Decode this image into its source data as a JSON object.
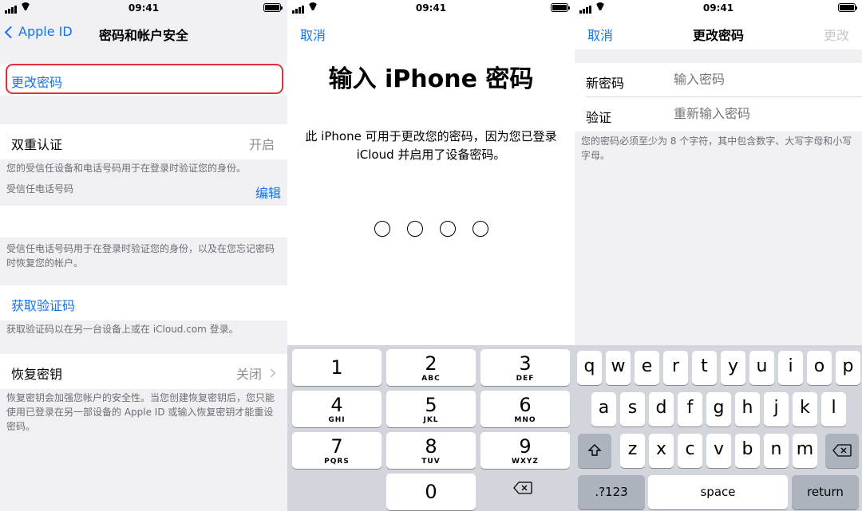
{
  "status_time": "09:41",
  "screen1": {
    "back_label": "Apple ID",
    "title": "密码和帐户安全",
    "change_password": "更改密码",
    "two_factor": {
      "label": "双重认证",
      "value": "开启"
    },
    "two_factor_note": "您的受信任设备和电话号码用于在登录时验证您的身份。",
    "trusted_phone_label": "受信任电话号码",
    "edit_label": "编辑",
    "phone_note": "受信任电话号码用于在登录时验证您的身份，以及在您忘记密码时恢复您的帐户。",
    "get_code": "获取验证码",
    "get_code_note": "获取验证码以在另一台设备上或在 iCloud.com 登录。",
    "recovery_key": {
      "label": "恢复密钥",
      "value": "关闭"
    },
    "recovery_note": "恢复密钥会加强您帐户的安全性。当您创建恢复密钥后，您只能使用已登录在另一部设备的 Apple ID 或输入恢复密钥才能重设密码。"
  },
  "screen2": {
    "cancel": "取消",
    "title": "输入 iPhone 密码",
    "description": "此 iPhone 可用于更改您的密码，因为您已登录 iCloud 并启用了设备密码。",
    "keys": [
      {
        "digit": "1",
        "letters": ""
      },
      {
        "digit": "2",
        "letters": "ABC"
      },
      {
        "digit": "3",
        "letters": "DEF"
      },
      {
        "digit": "4",
        "letters": "GHI"
      },
      {
        "digit": "5",
        "letters": "JKL"
      },
      {
        "digit": "6",
        "letters": "MNO"
      },
      {
        "digit": "7",
        "letters": "PQRS"
      },
      {
        "digit": "8",
        "letters": "TUV"
      },
      {
        "digit": "9",
        "letters": "WXYZ"
      },
      {
        "digit": "0",
        "letters": ""
      }
    ]
  },
  "screen3": {
    "cancel": "取消",
    "title": "更改密码",
    "change": "更改",
    "new_password_label": "新密码",
    "new_password_placeholder": "输入密码",
    "verify_label": "验证",
    "verify_placeholder": "重新输入密码",
    "note": "您的密码必须至少为 8 个字符，其中包含数字、大写字母和小写字母。",
    "row1": [
      "q",
      "w",
      "e",
      "r",
      "t",
      "y",
      "u",
      "i",
      "o",
      "p"
    ],
    "row2": [
      "a",
      "s",
      "d",
      "f",
      "g",
      "h",
      "j",
      "k",
      "l"
    ],
    "row3": [
      "z",
      "x",
      "c",
      "v",
      "b",
      "n",
      "m"
    ],
    "numbers_key": ".?123",
    "space_key": "space",
    "return_key": "return"
  }
}
